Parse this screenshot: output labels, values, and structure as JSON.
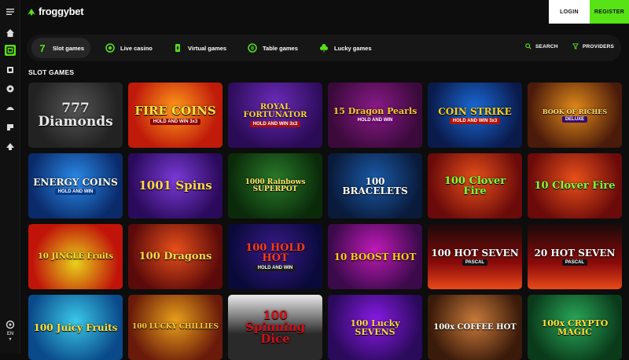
{
  "brand": {
    "name": "froggybet",
    "accent": "#57e315"
  },
  "header": {
    "login_label": "LOGIN",
    "register_label": "REGISTER"
  },
  "rail": {
    "icons": [
      "menu-icon",
      "home-icon",
      "slot-icon",
      "live-icon",
      "virtual-icon",
      "table-icon",
      "lucky-icon",
      "promo-icon"
    ],
    "language": "EN"
  },
  "categories": [
    {
      "label": "Slot games",
      "icon": "seven-icon",
      "active": true
    },
    {
      "label": "Live casino",
      "icon": "live-casino-icon",
      "active": false
    },
    {
      "label": "Virtual games",
      "icon": "virtual-icon",
      "active": false
    },
    {
      "label": "Table games",
      "icon": "table-icon",
      "active": false
    },
    {
      "label": "Lucky games",
      "icon": "clover-icon",
      "active": false
    }
  ],
  "search_label": "SEARCH",
  "providers_label": "PROVIDERS",
  "section_title": "SLOT GAMES",
  "games": [
    {
      "title": "777 Diamonds",
      "sub": ""
    },
    {
      "title": "FIRE COINS",
      "sub": "HOLD AND WIN 3x3"
    },
    {
      "title": "ROYAL FORTUNATOR",
      "sub": "HOLD AND WIN 3x3"
    },
    {
      "title": "15 Dragon Pearls",
      "sub": "HOLD AND WIN"
    },
    {
      "title": "COIN STRIKE",
      "sub": "HOLD AND WIN 3x3"
    },
    {
      "title": "BOOK OF RICHES",
      "sub": "DELUXE"
    },
    {
      "title": "ENERGY COINS",
      "sub": "HOLD AND WIN"
    },
    {
      "title": "1001 Spins",
      "sub": ""
    },
    {
      "title": "1000 Rainbows SUPERPOT",
      "sub": ""
    },
    {
      "title": "100 BRACELETS",
      "sub": ""
    },
    {
      "title": "100 Clover Fire",
      "sub": ""
    },
    {
      "title": "10 Clover Fire",
      "sub": ""
    },
    {
      "title": "10 JINGLE Fruits",
      "sub": ""
    },
    {
      "title": "100 Dragons",
      "sub": ""
    },
    {
      "title": "100 HOLD HOT",
      "sub": "HOLD AND WIN"
    },
    {
      "title": "10 BOOST HOT",
      "sub": ""
    },
    {
      "title": "100 HOT SEVEN",
      "sub": "PASCAL"
    },
    {
      "title": "20 HOT SEVEN",
      "sub": "PASCAL"
    },
    {
      "title": "100 Juicy Fruits",
      "sub": ""
    },
    {
      "title": "100 LUCKY CHILLIES",
      "sub": ""
    },
    {
      "title": "100 Spinning Dice",
      "sub": ""
    },
    {
      "title": "100 Lucky SEVENS",
      "sub": ""
    },
    {
      "title": "100x COFFEE HOT",
      "sub": ""
    },
    {
      "title": "100x CRYPTO MAGIC",
      "sub": ""
    }
  ]
}
